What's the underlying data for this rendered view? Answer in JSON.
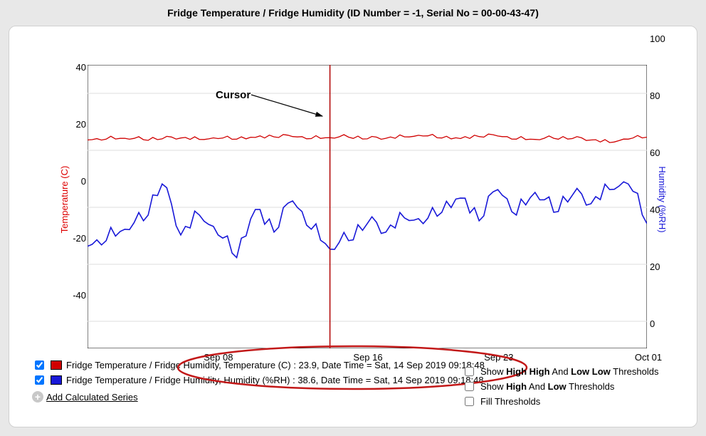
{
  "title": "Fridge Temperature / Fridge Humidity (ID Number = -1, Serial No = 00-00-43-47)",
  "cursor_label": "Cursor",
  "axes": {
    "left_label": "Temperature (C)",
    "right_label": "Humidity (%RH)",
    "left_ticks": [
      -40,
      -20,
      0,
      20,
      40
    ],
    "right_ticks": [
      0,
      20,
      40,
      60,
      80,
      100
    ],
    "bottom_ticks": [
      "Sep 08",
      "Sep 16",
      "Sep 23",
      "Oct 01"
    ]
  },
  "legend": {
    "temp": "Fridge Temperature / Fridge Humidity, Temperature (C) : 23.9, Date Time = Sat, 14 Sep 2019 09:18:48",
    "hum": "Fridge Temperature / Fridge Humidity, Humidity (%RH) : 38.6, Date Time = Sat, 14 Sep 2019 09:18:48",
    "add": "Add Calculated Series"
  },
  "thresholds": {
    "hh_ll_prefix": "Show ",
    "hh": "High High",
    "and": " And ",
    "ll": "Low Low",
    "suffix": " Thresholds",
    "h": "High",
    "l": "Low",
    "fill": "Fill Thresholds"
  },
  "chart_data": {
    "type": "line",
    "x_range_days": [
      "2019-09-01",
      "2019-10-01"
    ],
    "xticks": [
      "Sep 08",
      "Sep 16",
      "Sep 23",
      "Oct 01"
    ],
    "cursor_x": "2019-09-14 09:18:48",
    "left_axis": {
      "label": "Temperature (C)",
      "lim": [
        -50,
        50
      ],
      "ticks": [
        -40,
        -20,
        0,
        20,
        40
      ]
    },
    "right_axis": {
      "label": "Humidity (%RH)",
      "lim": [
        0,
        100
      ],
      "ticks": [
        0,
        20,
        40,
        60,
        80,
        100
      ]
    },
    "series": [
      {
        "name": "Temperature (C)",
        "axis": "left",
        "color": "#d00000",
        "values": [
          23.5,
          23.8,
          24.1,
          23.6,
          23.9,
          24.2,
          23.7,
          24.0,
          23.8,
          24.4,
          24.6,
          24.7,
          24.0,
          24.3,
          24.5,
          23.9,
          24.1,
          24.6,
          24.9,
          24.2,
          24.0,
          24.7,
          24.9,
          23.8,
          23.7,
          24.1,
          24.0,
          23.5,
          22.6,
          23.8,
          24.5
        ]
      },
      {
        "name": "Humidity (%RH)",
        "axis": "right",
        "color": "#1818d8",
        "values": [
          36,
          38,
          42,
          45,
          58,
          40,
          47,
          40,
          32,
          49,
          41,
          52,
          42,
          35,
          38,
          44,
          41,
          46,
          44,
          48,
          53,
          45,
          56,
          47,
          55,
          48,
          54,
          51,
          56,
          58,
          44
        ]
      }
    ],
    "cursor_readout": {
      "temperature_c": 23.9,
      "humidity_pct": 38.6,
      "datetime": "Sat, 14 Sep 2019 09:18:48"
    }
  }
}
